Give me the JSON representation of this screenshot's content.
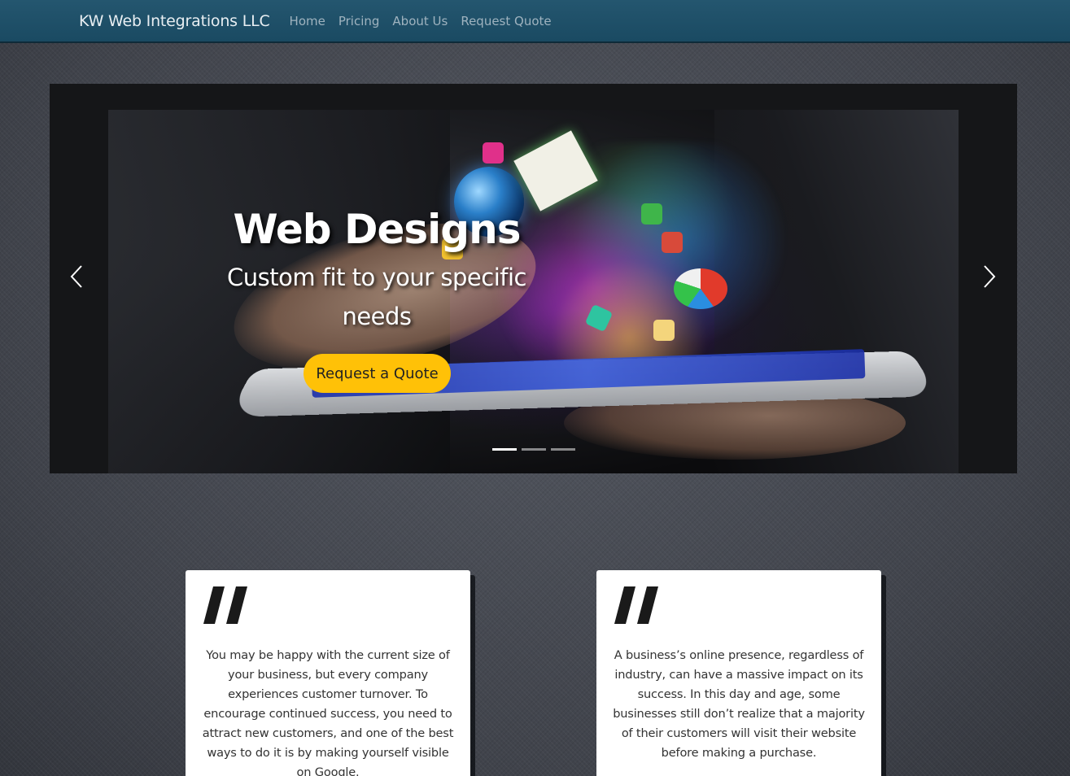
{
  "navbar": {
    "brand": "KW Web Integrations LLC",
    "links": [
      "Home",
      "Pricing",
      "About Us",
      "Request Quote"
    ]
  },
  "carousel": {
    "title": "Web Designs",
    "subtitle": "Custom fit to your specific needs",
    "button_label": "Request a Quote",
    "prev_icon": "chevron-left-icon",
    "next_icon": "chevron-right-icon",
    "slide_count": 3,
    "active_slide": 1
  },
  "cards": [
    {
      "quote_icon": "quote-icon",
      "text": "You may be happy with the current size of your business, but every company experiences customer turnover. To encourage continued success, you need to attract new customers, and one of the best ways to do it is by making yourself visible on Google."
    },
    {
      "quote_icon": "quote-icon",
      "text": "A business’s online presence, regardless of industry, can have a massive impact on its success. In this day and age, some businesses still don’t realize that a majority of their customers will visit their website before making a purchase."
    }
  ],
  "colors": {
    "navbar": "#1d4f67",
    "accent_button": "#ffc107",
    "card_background": "#ffffff"
  }
}
